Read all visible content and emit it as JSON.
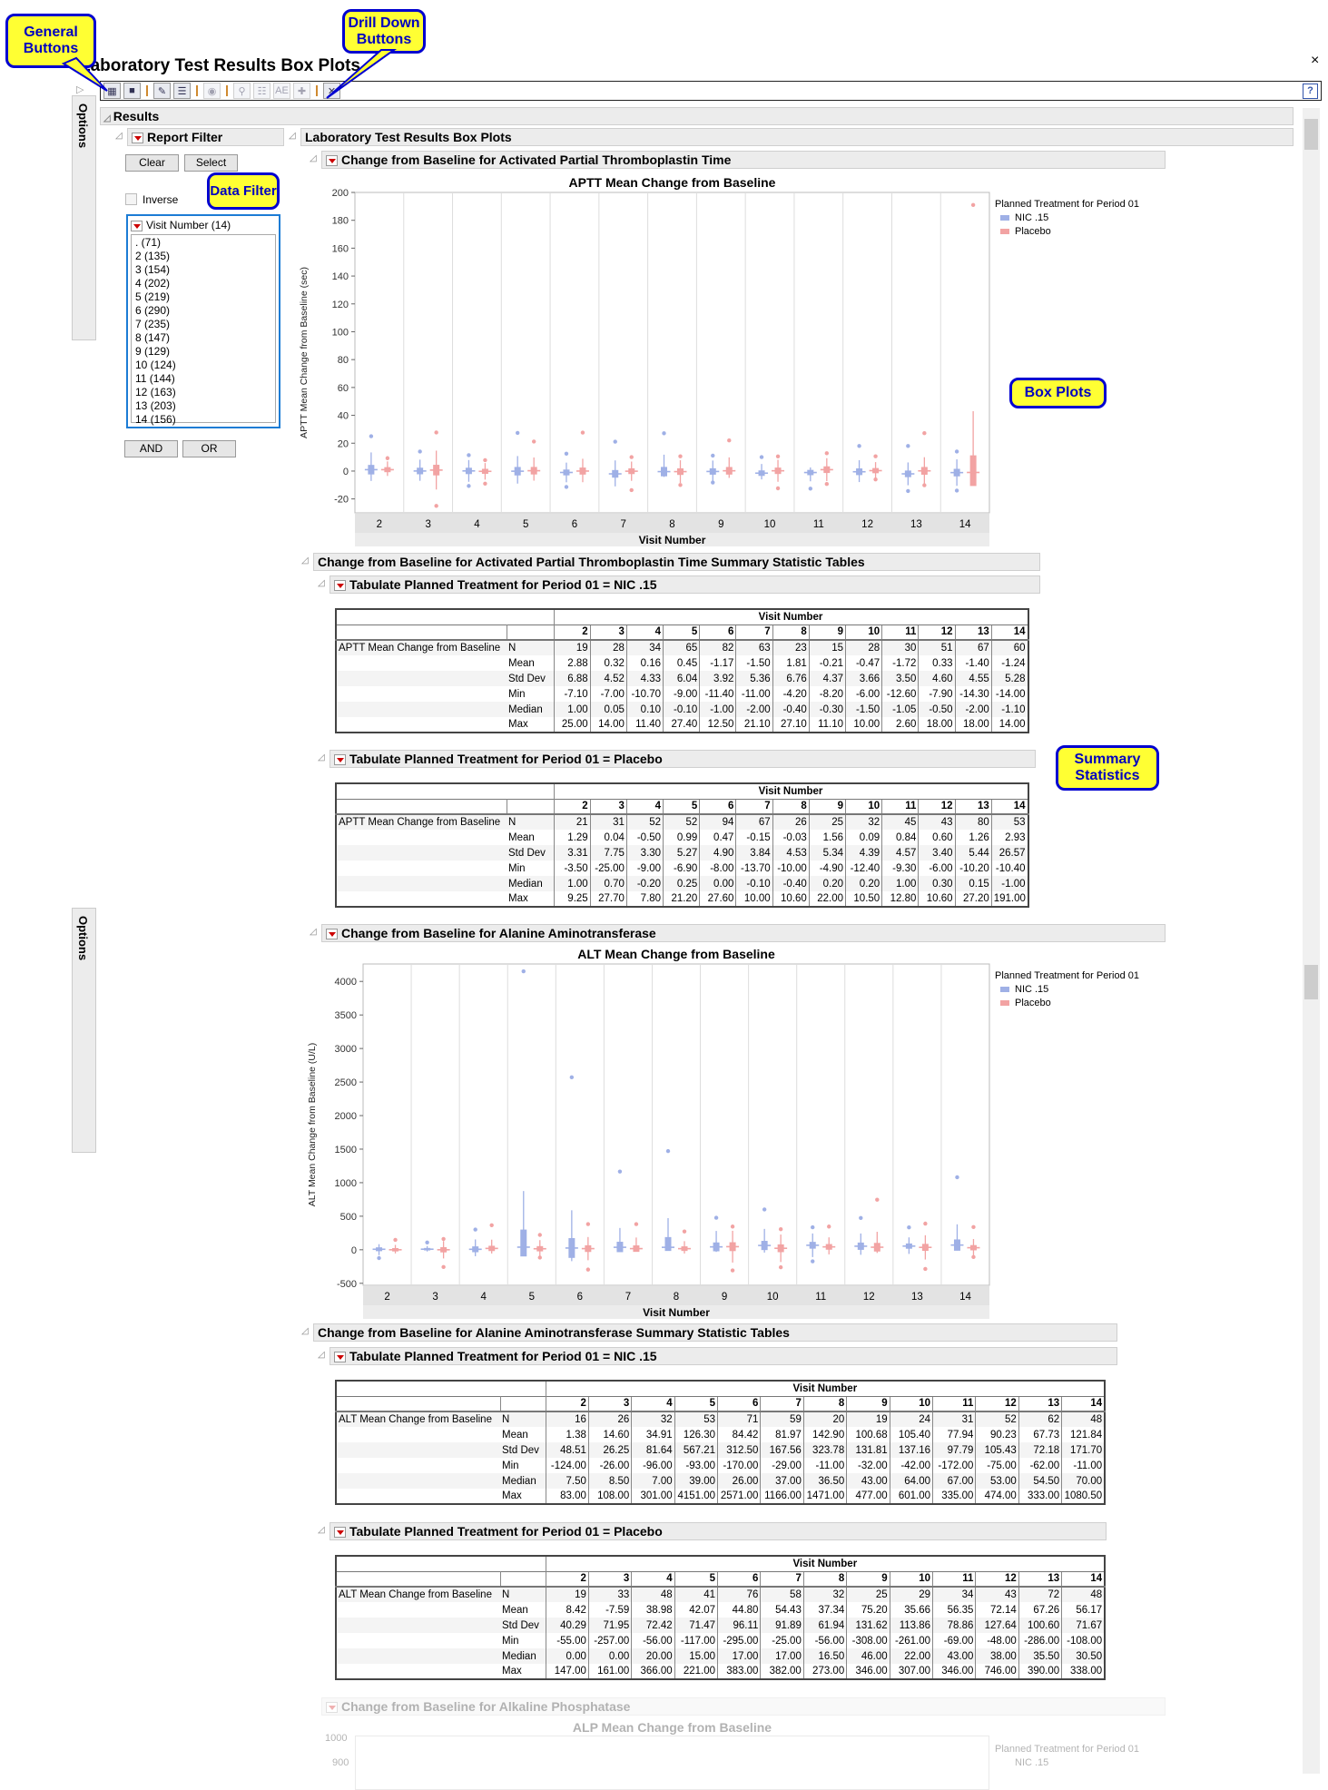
{
  "window": {
    "title": "Laboratory Test Results Box Plots",
    "close": "×",
    "help": "?"
  },
  "callouts": {
    "general": "General Buttons",
    "drill": "Drill Down Buttons",
    "filter": "Data Filter",
    "box": "Box Plots",
    "summary": "Summary Statistics"
  },
  "toolbar": [
    {
      "name": "data-table-button",
      "glyph": "▦",
      "enabled": true
    },
    {
      "name": "export-button",
      "glyph": "■",
      "enabled": true
    },
    {
      "sep": true
    },
    {
      "name": "add-comment-button",
      "glyph": "✎",
      "enabled": true
    },
    {
      "name": "view-comments-button",
      "glyph": "☰",
      "enabled": true
    },
    {
      "sep": true
    },
    {
      "name": "global-filter-button",
      "glyph": "◉",
      "enabled": false
    },
    {
      "sep": true
    },
    {
      "name": "profile-search-button",
      "glyph": "⚲",
      "enabled": false
    },
    {
      "name": "subject-profile-button",
      "glyph": "☷",
      "enabled": false
    },
    {
      "name": "ae-narrative-button",
      "glyph": "AE",
      "enabled": false
    },
    {
      "name": "add-filter-button",
      "glyph": "✚",
      "enabled": false
    },
    {
      "sep": true
    },
    {
      "name": "close-all-button",
      "glyph": "✕",
      "enabled": true
    }
  ],
  "options_label": "Options",
  "results_label": "Results",
  "filter": {
    "title": "Report Filter",
    "clear": "Clear",
    "select": "Select",
    "inverse": "Inverse",
    "list_title": "Visit Number (14)",
    "items": [
      ". (71)",
      "2 (135)",
      "3 (154)",
      "4 (202)",
      "5 (219)",
      "6 (290)",
      "7 (235)",
      "8 (147)",
      "9 (129)",
      "10 (124)",
      "11 (144)",
      "12 (163)",
      "13 (203)",
      "14 (156)"
    ],
    "and": "AND",
    "or": "OR"
  },
  "main_title": "Laboratory Test Results Box Plots",
  "visits": [
    "2",
    "3",
    "4",
    "5",
    "6",
    "7",
    "8",
    "9",
    "10",
    "11",
    "12",
    "13",
    "14"
  ],
  "stats": [
    "N",
    "Mean",
    "Std Dev",
    "Min",
    "Median",
    "Max"
  ],
  "legend": {
    "title": "Planned Treatment for Period 01",
    "items": [
      {
        "label": "NIC .15",
        "color": "#9fb0e6"
      },
      {
        "label": "Placebo",
        "color": "#f2a3a3"
      }
    ]
  },
  "aptt": {
    "section": "Change from Baseline for Activated Partial Thromboplastin Time",
    "plot_title": "APTT Mean Change from Baseline",
    "ylabel": "APTT Mean Change from Baseline (sec)",
    "xlabel": "Visit Number",
    "ylim": [
      -30,
      200
    ],
    "ticks": [
      200,
      180,
      160,
      140,
      120,
      100,
      80,
      60,
      40,
      20,
      0,
      -20
    ],
    "summary_section": "Change from Baseline for Activated Partial Thromboplastin Time Summary Statistic Tables",
    "tables": [
      {
        "title": "Tabulate Planned Treatment for Period 01 = NIC .15",
        "row_label": "APTT Mean Change from Baseline",
        "col_header": "Visit Number",
        "rows": [
          [
            "19",
            "28",
            "34",
            "65",
            "82",
            "63",
            "23",
            "15",
            "28",
            "30",
            "51",
            "67",
            "60"
          ],
          [
            "2.88",
            "0.32",
            "0.16",
            "0.45",
            "-1.17",
            "-1.50",
            "1.81",
            "-0.21",
            "-0.47",
            "-1.72",
            "0.33",
            "-1.40",
            "-1.24"
          ],
          [
            "6.88",
            "4.52",
            "4.33",
            "6.04",
            "3.92",
            "5.36",
            "6.76",
            "4.37",
            "3.66",
            "3.50",
            "4.60",
            "4.55",
            "5.28"
          ],
          [
            "-7.10",
            "-7.00",
            "-10.70",
            "-9.00",
            "-11.40",
            "-11.00",
            "-4.20",
            "-8.20",
            "-6.00",
            "-12.60",
            "-7.90",
            "-14.30",
            "-14.00"
          ],
          [
            "1.00",
            "0.05",
            "0.10",
            "-0.10",
            "-1.00",
            "-2.00",
            "-0.40",
            "-0.30",
            "-1.50",
            "-1.05",
            "-0.50",
            "-2.00",
            "-1.10"
          ],
          [
            "25.00",
            "14.00",
            "11.40",
            "27.40",
            "12.50",
            "21.10",
            "27.10",
            "11.10",
            "10.00",
            "2.60",
            "18.00",
            "18.00",
            "14.00"
          ]
        ]
      },
      {
        "title": "Tabulate Planned Treatment for Period 01 = Placebo",
        "row_label": "APTT Mean Change from Baseline",
        "col_header": "Visit Number",
        "rows": [
          [
            "21",
            "31",
            "52",
            "52",
            "94",
            "67",
            "26",
            "25",
            "32",
            "45",
            "43",
            "80",
            "53"
          ],
          [
            "1.29",
            "0.04",
            "-0.50",
            "0.99",
            "0.47",
            "-0.15",
            "-0.03",
            "1.56",
            "0.09",
            "0.84",
            "0.60",
            "1.26",
            "2.93"
          ],
          [
            "3.31",
            "7.75",
            "3.30",
            "5.27",
            "4.90",
            "3.84",
            "4.53",
            "5.34",
            "4.39",
            "4.57",
            "3.40",
            "5.44",
            "26.57"
          ],
          [
            "-3.50",
            "-25.00",
            "-9.00",
            "-6.90",
            "-8.00",
            "-13.70",
            "-10.00",
            "-4.90",
            "-12.40",
            "-9.30",
            "-6.00",
            "-10.20",
            "-10.40"
          ],
          [
            "1.00",
            "0.70",
            "-0.20",
            "0.25",
            "0.00",
            "-0.10",
            "-0.40",
            "0.20",
            "0.20",
            "1.00",
            "0.30",
            "0.15",
            "-1.00"
          ],
          [
            "9.25",
            "27.70",
            "7.80",
            "21.20",
            "27.60",
            "10.00",
            "10.60",
            "22.00",
            "10.50",
            "12.80",
            "10.60",
            "27.20",
            "191.00"
          ]
        ]
      }
    ]
  },
  "alt": {
    "section": "Change from Baseline for Alanine Aminotransferase",
    "plot_title": "ALT Mean Change from Baseline",
    "ylabel": "ALT Mean Change from Baseline (U/L)",
    "xlabel": "Visit Number",
    "ylim": [
      -530,
      4260
    ],
    "ticks": [
      4000,
      3500,
      3000,
      2500,
      2000,
      1500,
      1000,
      500,
      0,
      -500
    ],
    "summary_section": "Change from Baseline for Alanine Aminotransferase Summary Statistic Tables",
    "tables": [
      {
        "title": "Tabulate Planned Treatment for Period 01 = NIC .15",
        "row_label": "ALT Mean Change from Baseline",
        "col_header": "Visit Number",
        "rows": [
          [
            "16",
            "26",
            "32",
            "53",
            "71",
            "59",
            "20",
            "19",
            "24",
            "31",
            "52",
            "62",
            "48"
          ],
          [
            "1.38",
            "14.60",
            "34.91",
            "126.30",
            "84.42",
            "81.97",
            "142.90",
            "100.68",
            "105.40",
            "77.94",
            "90.23",
            "67.73",
            "121.84"
          ],
          [
            "48.51",
            "26.25",
            "81.64",
            "567.21",
            "312.50",
            "167.56",
            "323.78",
            "131.81",
            "137.16",
            "97.79",
            "105.43",
            "72.18",
            "171.70"
          ],
          [
            "-124.00",
            "-26.00",
            "-96.00",
            "-93.00",
            "-170.00",
            "-29.00",
            "-11.00",
            "-32.00",
            "-42.00",
            "-172.00",
            "-75.00",
            "-62.00",
            "-11.00"
          ],
          [
            "7.50",
            "8.50",
            "7.00",
            "39.00",
            "26.00",
            "37.00",
            "36.50",
            "43.00",
            "64.00",
            "67.00",
            "53.00",
            "54.50",
            "70.00"
          ],
          [
            "83.00",
            "108.00",
            "301.00",
            "4151.00",
            "2571.00",
            "1166.00",
            "1471.00",
            "477.00",
            "601.00",
            "335.00",
            "474.00",
            "333.00",
            "1080.50"
          ]
        ]
      },
      {
        "title": "Tabulate Planned Treatment for Period 01 = Placebo",
        "row_label": "ALT Mean Change from Baseline",
        "col_header": "Visit Number",
        "rows": [
          [
            "19",
            "33",
            "48",
            "41",
            "76",
            "58",
            "32",
            "25",
            "29",
            "34",
            "43",
            "72",
            "48"
          ],
          [
            "8.42",
            "-7.59",
            "38.98",
            "42.07",
            "44.80",
            "54.43",
            "37.34",
            "75.20",
            "35.66",
            "56.35",
            "72.14",
            "67.26",
            "56.17"
          ],
          [
            "40.29",
            "71.95",
            "72.42",
            "71.47",
            "96.11",
            "91.89",
            "61.94",
            "131.62",
            "113.86",
            "78.86",
            "127.64",
            "100.60",
            "71.67"
          ],
          [
            "-55.00",
            "-257.00",
            "-56.00",
            "-117.00",
            "-295.00",
            "-25.00",
            "-56.00",
            "-308.00",
            "-261.00",
            "-69.00",
            "-48.00",
            "-286.00",
            "-108.00"
          ],
          [
            "0.00",
            "0.00",
            "20.00",
            "15.00",
            "17.00",
            "17.00",
            "16.50",
            "46.00",
            "22.00",
            "43.00",
            "38.00",
            "35.50",
            "30.50"
          ],
          [
            "147.00",
            "161.00",
            "366.00",
            "221.00",
            "383.00",
            "382.00",
            "273.00",
            "346.00",
            "307.00",
            "346.00",
            "746.00",
            "390.00",
            "338.00"
          ]
        ]
      }
    ]
  },
  "alp": {
    "section": "Change from Baseline for Alkaline Phosphatase",
    "plot_title": "ALP Mean Change from Baseline",
    "ticks": [
      "1000",
      "900"
    ],
    "legend_title": "Planned Treatment for Period 01",
    "legend_item": "NIC .15"
  }
}
